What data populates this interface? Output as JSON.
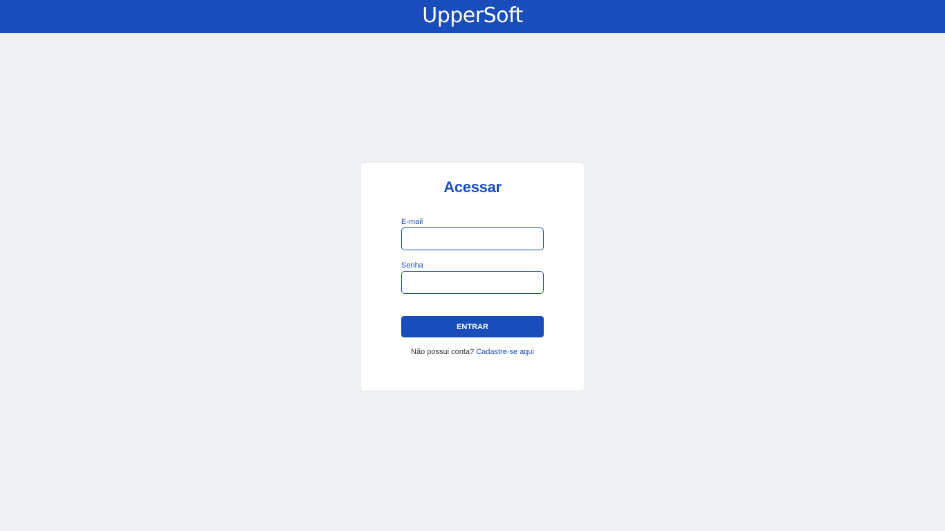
{
  "header": {
    "logo_text": "UpperSoft"
  },
  "login": {
    "title": "Acessar",
    "email_label": "E-mail",
    "email_value": "",
    "password_label": "Senha",
    "password_value": "",
    "submit_label": "ENTRAR",
    "signup_prompt": "Não possui conta?",
    "signup_link": "Cadastre-se aqui"
  },
  "colors": {
    "brand": "#184dbb",
    "background": "#eef0f4",
    "card": "#ffffff"
  }
}
